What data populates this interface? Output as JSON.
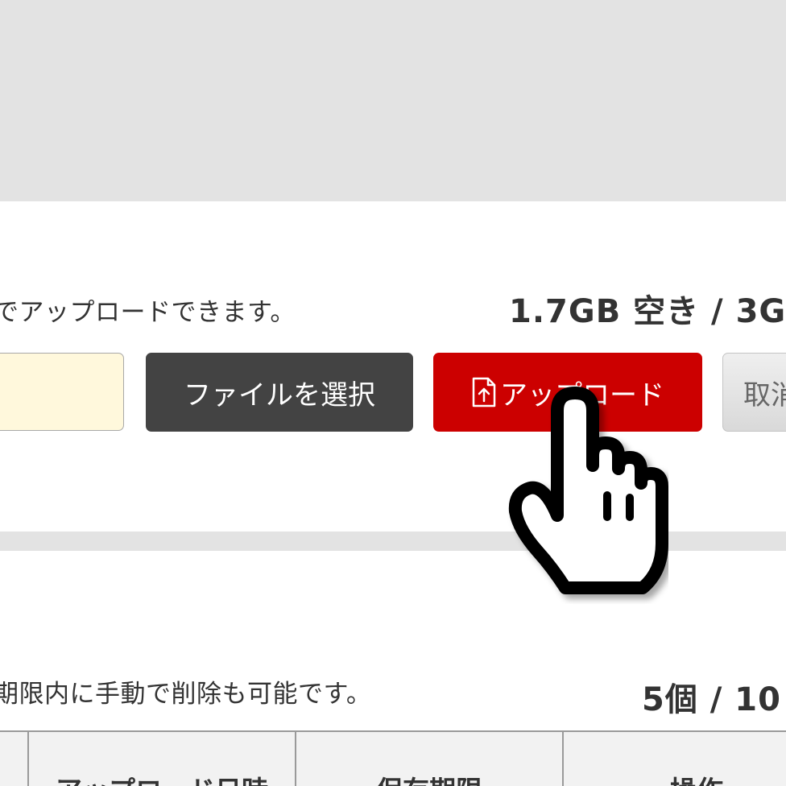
{
  "upload_section": {
    "note": "でアップロードできます。",
    "storage_usage": "1.7GB 空き / 3G",
    "file_name_value": "",
    "select_button_label": "ファイルを選択",
    "upload_button_label": "アップロード",
    "upload_button_icon": "file-upload-icon",
    "cancel_button_label": "取消"
  },
  "files_section": {
    "note": "期限内に手動で削除も可能です。",
    "file_count": "5個 / 10",
    "columns": [
      "",
      "アップロード日時",
      "保存期限",
      "操作"
    ]
  },
  "cursor": "hand-pointer-icon",
  "colors": {
    "background_band": "#e3e3e3",
    "select_button": "#434343",
    "upload_button": "#cc0000",
    "file_name_box": "#fff8dc"
  }
}
